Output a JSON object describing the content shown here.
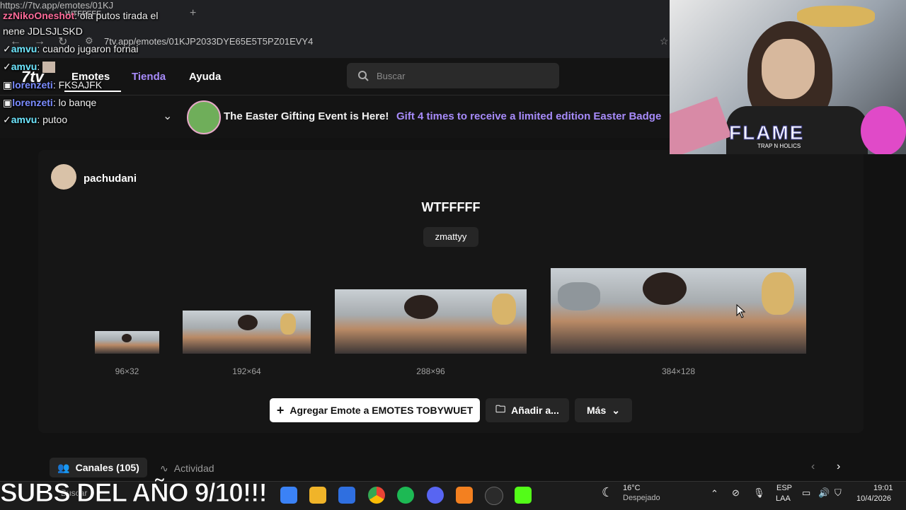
{
  "browser": {
    "tab_title": "WTFFFFF",
    "url_top": "https://7tv.app/emotes/01KJ",
    "url": "7tv.app/emotes/01KJP2033DYE65E5T5PZ01EVY4"
  },
  "site": {
    "logo": "7tv",
    "nav": [
      "Emotes",
      "Tienda",
      "Ayuda"
    ],
    "search_placeholder": "Buscar"
  },
  "banner": {
    "title": "The Easter Gifting Event is Here!",
    "subtitle": "Gift 4 times to receive a limited edition Easter Badge"
  },
  "emote": {
    "owner": "pachudani",
    "name": "WTFFFFF",
    "tag": "zmattyy",
    "sizes": [
      "96×32",
      "192×64",
      "288×96",
      "384×128"
    ]
  },
  "actions": {
    "add": "Agregar Emote a EMOTES TOBYWUET",
    "add_to": "Añadir a...",
    "more": "Más"
  },
  "tabs": {
    "channels": "Canales (105)",
    "activity": "Actividad"
  },
  "chat": [
    {
      "user": "zzNikoOneshot",
      "text": "ola putos tirada el"
    },
    {
      "user": "",
      "text": "nene JDLSJLSKD"
    },
    {
      "user": "amvu",
      "text": "cuando jugaron fornai"
    },
    {
      "user": "amvu",
      "text": ""
    },
    {
      "user": "lorenzeti",
      "text": "FKSAJFK"
    },
    {
      "user": "lorenzeti",
      "text": "lo banqe"
    },
    {
      "user": "amvu",
      "text": "putoo"
    }
  ],
  "overlay": {
    "subs": "SUBS DEL AÑO 9/10!!!",
    "webcam_logo": "FLAME",
    "webcam_sub": "TRAP N HOLICS"
  },
  "taskbar": {
    "search": "Buscar",
    "weather_temp": "16°C",
    "weather_desc": "Despejado",
    "lang_top": "ESP",
    "lang_bottom": "LAA",
    "time": "19:01",
    "date": "10/4/2026"
  },
  "colors": {
    "accent": "#a78bfa",
    "background": "#121212"
  }
}
